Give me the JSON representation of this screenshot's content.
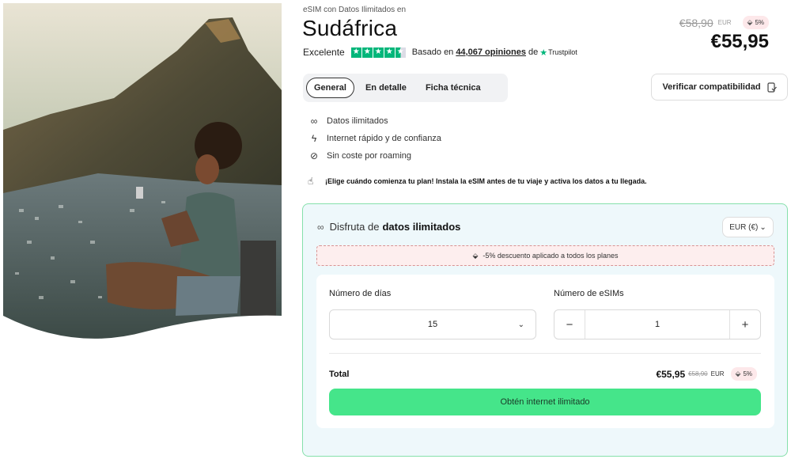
{
  "hero": {
    "image": "woman-with-phone-on-table-mountain"
  },
  "header": {
    "kicker": "eSIM con Datos Ilimitados en",
    "title": "Sudáfrica",
    "rating_word": "Excelente",
    "based_on": "Basado en",
    "reviews": "44,067 opiniones",
    "de": "de",
    "trustpilot": "Trustpilot"
  },
  "price": {
    "old": "€58,90",
    "old_currency": "EUR",
    "badge": "5%",
    "new": "€55,95"
  },
  "tabs": [
    {
      "label": "General",
      "active": true
    },
    {
      "label": "En detalle",
      "active": false
    },
    {
      "label": "Ficha técnica",
      "active": false
    }
  ],
  "verify_button": "Verificar compatibilidad",
  "features": [
    {
      "icon": "infinity-icon",
      "text": "Datos ilimitados"
    },
    {
      "icon": "lightning-icon",
      "text": "Internet rápido y de confianza"
    },
    {
      "icon": "no-roaming-icon",
      "text": "Sin coste por roaming"
    }
  ],
  "notice": "¡Elige cuándo comienza tu plan! Instala la eSIM antes de tu viaje y activa los datos a tu llegada.",
  "plan": {
    "heading_prefix": "Disfruta de",
    "heading_bold": "datos ilimitados",
    "currency_select": "EUR (€)",
    "discount": "-5% descuento aplicado a todos los planes",
    "days_label": "Número de días",
    "days_value": "15",
    "esims_label": "Número de eSIMs",
    "esims_value": "1",
    "minus": "−",
    "plus": "+",
    "total_label": "Total",
    "total_price": "€55,95",
    "total_old": "€58,90",
    "total_currency": "EUR",
    "total_badge": "5%",
    "cta": "Obtén internet ilimitado"
  },
  "colors": {
    "accent_green": "#45e58a",
    "trustpilot_green": "#00b67a",
    "card_border": "#86e0ab"
  }
}
